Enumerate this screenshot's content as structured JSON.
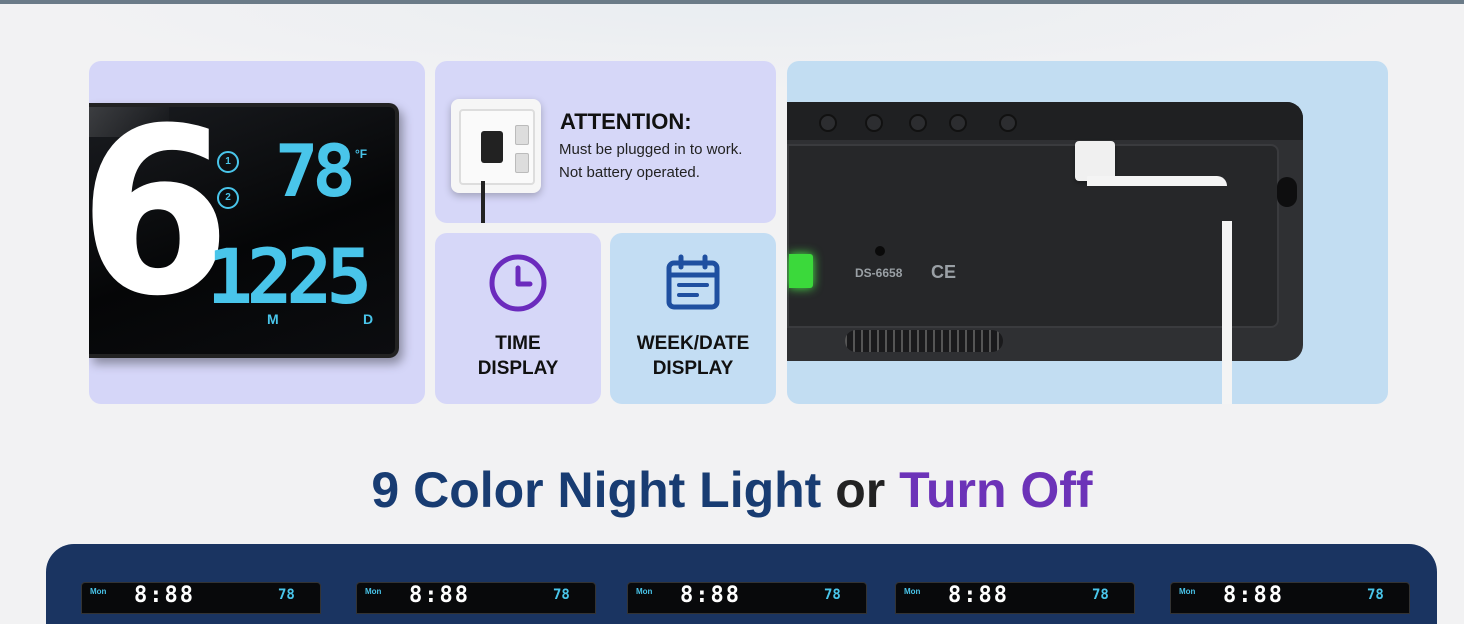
{
  "colors": {
    "heading_blue": "#183c72",
    "heading_purple": "#6c33b8",
    "display_cyan": "#49c5ea",
    "banner_navy": "#1a3461"
  },
  "clock": {
    "big_digit": "6",
    "temperature": "78",
    "temperature_unit": "°F",
    "alarm1": "1",
    "alarm2": "2",
    "date": "1225",
    "month_label": "M",
    "day_label": "D"
  },
  "attention": {
    "title": "ATTENTION:",
    "line1": "Must be plugged in to work.",
    "line2": "Not battery operated."
  },
  "features": [
    {
      "icon": "clock-icon",
      "line1": "TIME",
      "line2": "DISPLAY"
    },
    {
      "icon": "calendar-icon",
      "line1": "WEEK/DATE",
      "line2": "DISPLAY"
    }
  ],
  "back": {
    "model": "DS-6658",
    "ce_mark": "CE"
  },
  "heading": {
    "part1": "9 Color Night Light",
    "part2": " or ",
    "part3": "Turn Off"
  },
  "mini_displays": [
    {
      "day": "Mon",
      "time": "8:88",
      "temp": "78"
    },
    {
      "day": "Mon",
      "time": "8:88",
      "temp": "78"
    },
    {
      "day": "Mon",
      "time": "8:88",
      "temp": "78"
    },
    {
      "day": "Mon",
      "time": "8:88",
      "temp": "78"
    },
    {
      "day": "Mon",
      "time": "8:88",
      "temp": "78"
    }
  ]
}
